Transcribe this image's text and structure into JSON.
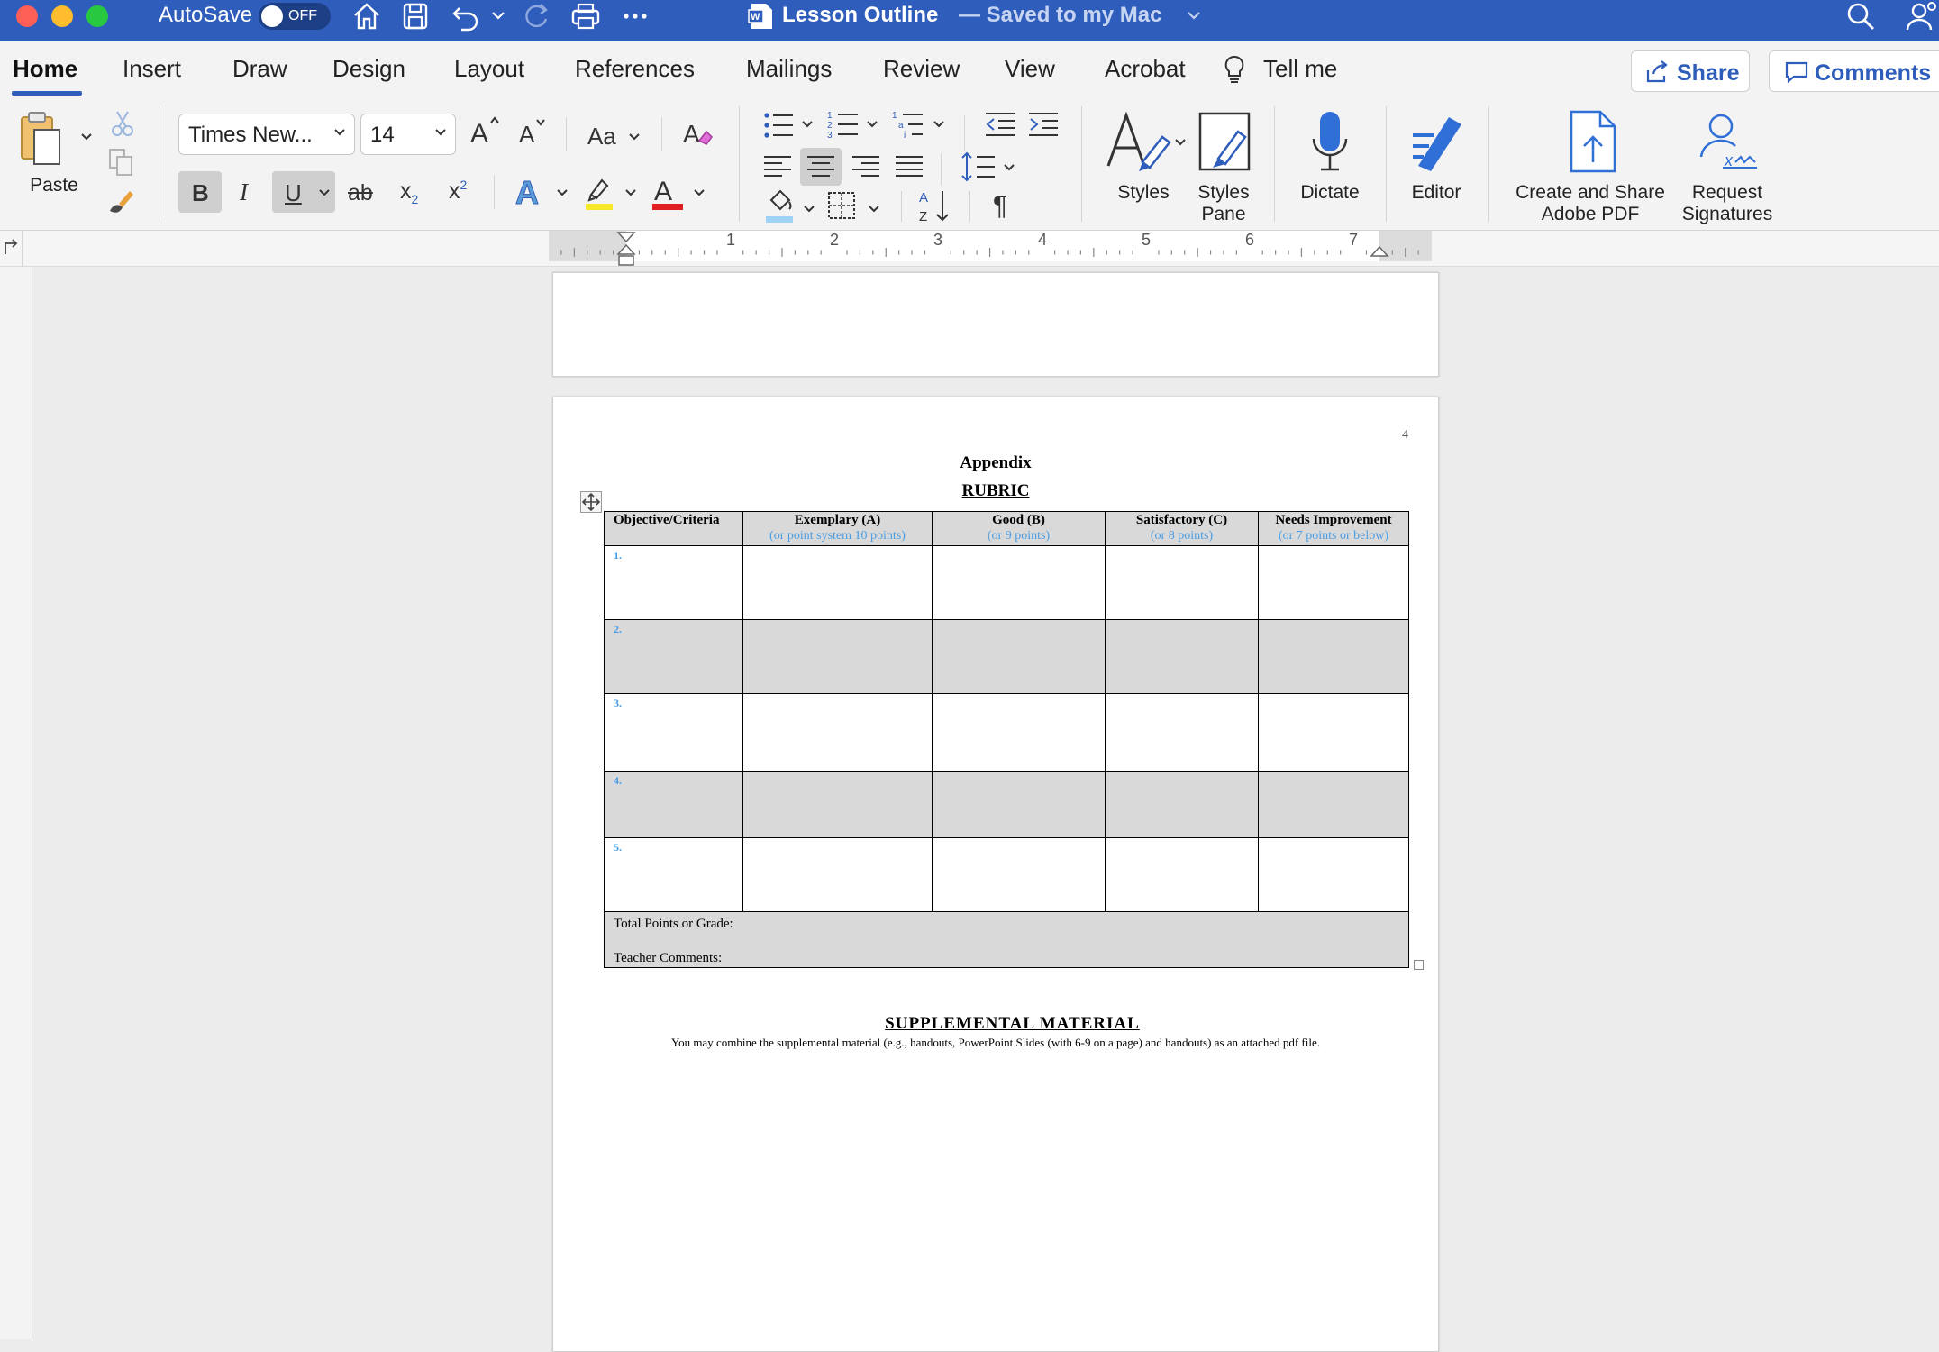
{
  "window": {
    "autosave_label": "AutoSave",
    "autosave_state": "OFF",
    "doc_title": "Lesson Outline",
    "doc_status": "— Saved to my Mac"
  },
  "ribbon_tabs": [
    "Home",
    "Insert",
    "Draw",
    "Design",
    "Layout",
    "References",
    "Mailings",
    "Review",
    "View",
    "Acrobat"
  ],
  "tell_me": "Tell me",
  "share_label": "Share",
  "comments_label": "Comments",
  "ribbon": {
    "paste_label": "Paste",
    "font_name": "Times New...",
    "font_size": "14",
    "change_case_label": "Aa",
    "styles_label": "Styles",
    "styles_pane_label_1": "Styles",
    "styles_pane_label_2": "Pane",
    "dictate_label": "Dictate",
    "editor_label": "Editor",
    "adobe_label_1": "Create and Share",
    "adobe_label_2": "Adobe PDF",
    "request_label_1": "Request",
    "request_label_2": "Signatures",
    "bold_glyph": "B",
    "italic_glyph": "I",
    "underline_glyph": "U",
    "strike_glyph": "ab",
    "sub_glyph": "x",
    "super_glyph": "x",
    "pilcrow": "¶"
  },
  "ruler": {
    "numbers": [
      "1",
      "2",
      "3",
      "4",
      "5",
      "6",
      "7"
    ]
  },
  "document": {
    "page_number": "4",
    "appendix_heading": "Appendix",
    "rubric_heading": "RUBRIC",
    "columns": [
      {
        "title": "Objective/Criteria",
        "sub": ""
      },
      {
        "title": "Exemplary (A)",
        "sub": "(or point system 10 points)"
      },
      {
        "title": "Good (B)",
        "sub": "(or 9 points)"
      },
      {
        "title": "Satisfactory (C)",
        "sub": "(or 8 points)"
      },
      {
        "title": "Needs Improvement",
        "sub": "(or 7 points or below)"
      }
    ],
    "rows": [
      "1.",
      "2.",
      "3.",
      "4.",
      "5."
    ],
    "total_label": "Total Points or Grade:",
    "comments_label": "Teacher Comments:",
    "supplemental_heading": "SUPPLEMENTAL MATERIAL",
    "supplemental_text": "You may combine the supplemental material (e.g., handouts, PowerPoint Slides (with 6-9 on a page) and handouts) as an attached pdf file."
  },
  "colors": {
    "title_bar": "#2f5dbb",
    "accent_blue": "#2f5dbb",
    "field_text_blue": "#4a9de3",
    "table_shade": "#d9d9d9"
  }
}
